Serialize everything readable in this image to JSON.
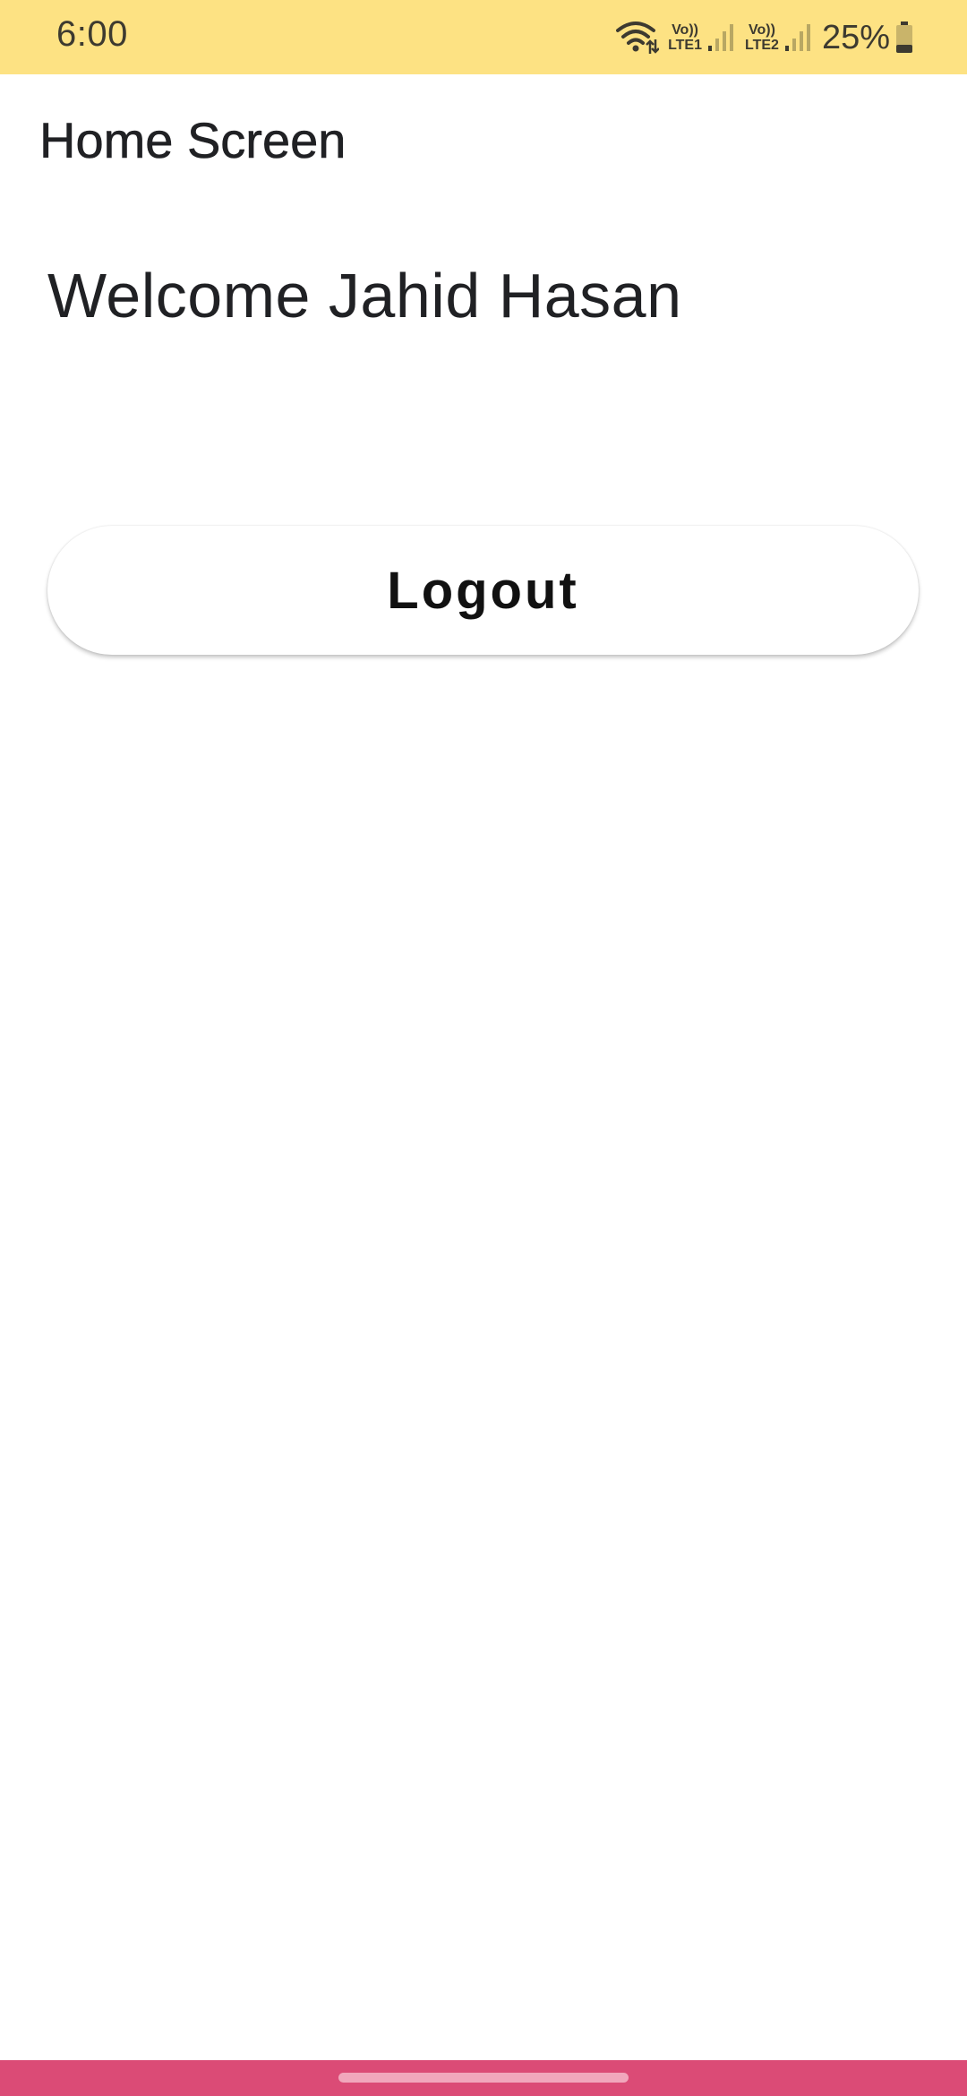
{
  "status_bar": {
    "time": "6:00",
    "sim1_top": "Vo))",
    "sim1_bottom": "LTE1",
    "sim2_top": "Vo))",
    "sim2_bottom": "LTE2",
    "battery_percent": "25%",
    "background_color": "#fde283"
  },
  "app_bar": {
    "title": "Home Screen"
  },
  "main": {
    "welcome_text": "Welcome Jahid Hasan",
    "logout_label": "Logout"
  },
  "nav_bar": {
    "background_color": "#db4b76"
  },
  "icons": [
    "wifi-icon",
    "signal-icon",
    "battery-icon"
  ]
}
